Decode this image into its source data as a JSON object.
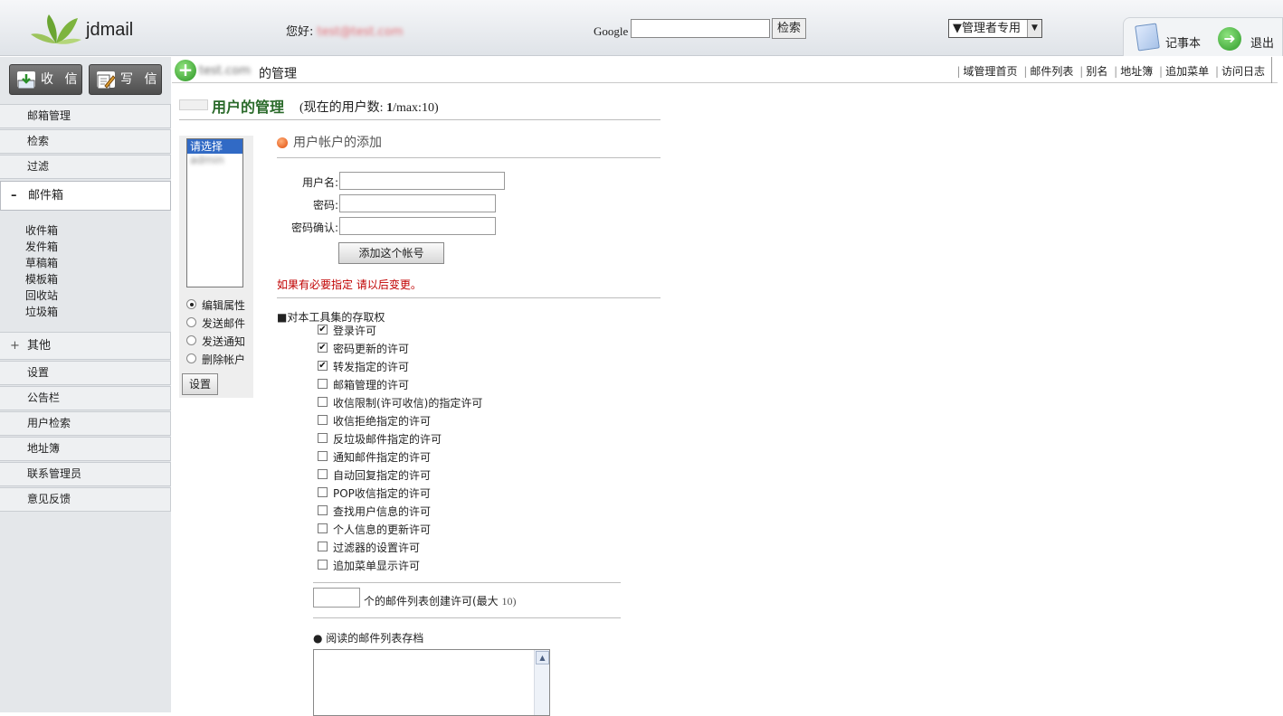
{
  "header": {
    "logo_text": "jdmail",
    "greeting_prefix": "您好:",
    "greeting_user": "test@test.com",
    "search_label": "Google",
    "search_value": "",
    "search_button": "检索",
    "admin_select": "▼管理者专用",
    "notebook_label": "记事本",
    "logout_label": "退出"
  },
  "sidebar": {
    "receive_button": "收 信",
    "compose_button": "写 信",
    "top_items": [
      "邮箱管理",
      "检索",
      "过滤"
    ],
    "mailbox_label": "邮件箱",
    "folders": [
      "收件箱",
      "发件箱",
      "草稿箱",
      "模板箱",
      "回收站",
      "垃圾箱"
    ],
    "other_label": "其他",
    "other_items": [
      "设置",
      "公告栏",
      "用户检索",
      "地址簿",
      "联系管理员",
      "意见反馈"
    ]
  },
  "main": {
    "domain_name": "test.com",
    "domain_title_suffix": "的管理",
    "nav_links": [
      "域管理首页",
      "邮件列表",
      "别名",
      "地址簿",
      "追加菜单",
      "访问日志"
    ],
    "page_title": "用户的管理",
    "page_subtitle_prefix": "(现在的用户数:",
    "user_count": "1",
    "page_subtitle_suffix": "/max:10)"
  },
  "user_panel": {
    "list_selected": "请选择",
    "list_user": "admin",
    "options": [
      "编辑属性",
      "发送邮件",
      "发送通知",
      "删除帐户"
    ],
    "selected_option": "编辑属性",
    "set_button": "设置"
  },
  "form": {
    "section_title": "用户帐户的添加",
    "username_label": "用户名:",
    "password_label": "密码:",
    "confirm_label": "密码确认:",
    "username_value": "",
    "password_value": "",
    "confirm_value": "",
    "add_button": "添加这个帐号",
    "note": "如果有必要指定 请以后变更。",
    "perm_title": "■对本工具集的存取权",
    "permissions": [
      {
        "label": "登录许可",
        "checked": true
      },
      {
        "label": "密码更新的许可",
        "checked": true
      },
      {
        "label": "转发指定的许可",
        "checked": true
      },
      {
        "label": "邮箱管理的许可",
        "checked": false
      },
      {
        "label": "收信限制(许可收信)的指定许可",
        "checked": false
      },
      {
        "label": "收信拒绝指定的许可",
        "checked": false
      },
      {
        "label": "反垃圾邮件指定的许可",
        "checked": false
      },
      {
        "label": "通知邮件指定的许可",
        "checked": false
      },
      {
        "label": "自动回复指定的许可",
        "checked": false
      },
      {
        "label": "POP收信指定的许可",
        "checked": false
      },
      {
        "label": "查找用户信息的许可",
        "checked": false
      },
      {
        "label": "个人信息的更新许可",
        "checked": false
      },
      {
        "label": "过滤器的设置许可",
        "checked": false
      },
      {
        "label": "追加菜单显示许可",
        "checked": false
      }
    ],
    "mailing_list_value": "",
    "mailing_list_label": "个的邮件列表创建许可(最大",
    "mailing_list_max": "10)",
    "archive_label": "●  阅读的邮件列表存档",
    "archive_value": ""
  }
}
